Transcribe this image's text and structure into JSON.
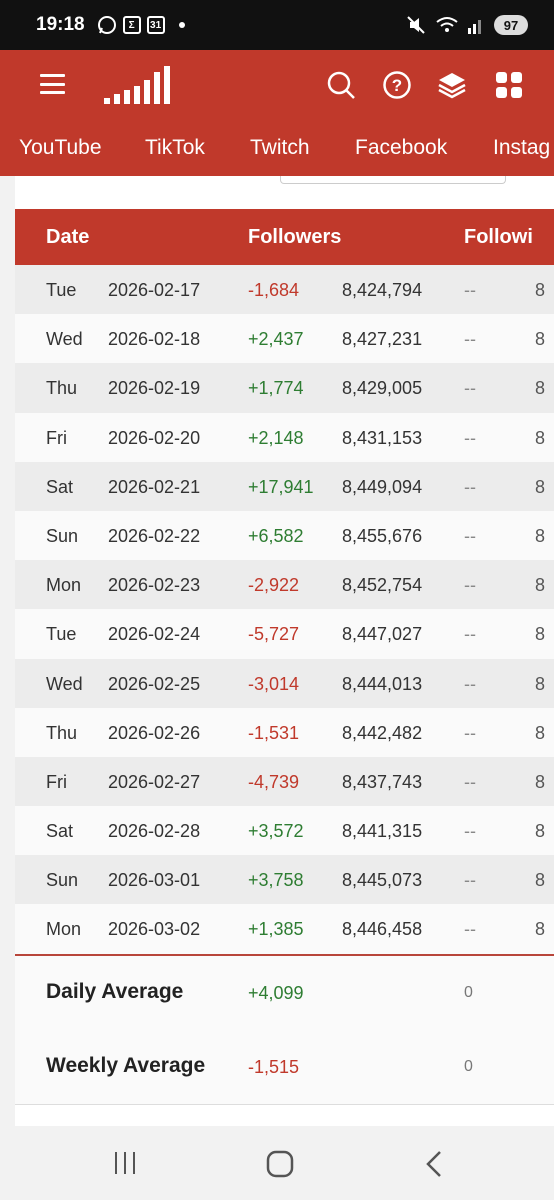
{
  "status_bar": {
    "time": "19:18",
    "calendar_day": "31",
    "battery": "97"
  },
  "nav_tabs": [
    "YouTube",
    "TikTok",
    "Twitch",
    "Facebook",
    "Instag"
  ],
  "table": {
    "headers": [
      "Date",
      "Followers",
      "Followi"
    ],
    "rows": [
      {
        "day": "Tue",
        "date": "2026-02-17",
        "change": "-1,684",
        "total": "8,424,794",
        "following": "--",
        "clip": "8"
      },
      {
        "day": "Wed",
        "date": "2026-02-18",
        "change": "+2,437",
        "total": "8,427,231",
        "following": "--",
        "clip": "8"
      },
      {
        "day": "Thu",
        "date": "2026-02-19",
        "change": "+1,774",
        "total": "8,429,005",
        "following": "--",
        "clip": "8"
      },
      {
        "day": "Fri",
        "date": "2026-02-20",
        "change": "+2,148",
        "total": "8,431,153",
        "following": "--",
        "clip": "8"
      },
      {
        "day": "Sat",
        "date": "2026-02-21",
        "change": "+17,941",
        "total": "8,449,094",
        "following": "--",
        "clip": "8"
      },
      {
        "day": "Sun",
        "date": "2026-02-22",
        "change": "+6,582",
        "total": "8,455,676",
        "following": "--",
        "clip": "8"
      },
      {
        "day": "Mon",
        "date": "2026-02-23",
        "change": "-2,922",
        "total": "8,452,754",
        "following": "--",
        "clip": "8"
      },
      {
        "day": "Tue",
        "date": "2026-02-24",
        "change": "-5,727",
        "total": "8,447,027",
        "following": "--",
        "clip": "8"
      },
      {
        "day": "Wed",
        "date": "2026-02-25",
        "change": "-3,014",
        "total": "8,444,013",
        "following": "--",
        "clip": "8"
      },
      {
        "day": "Thu",
        "date": "2026-02-26",
        "change": "-1,531",
        "total": "8,442,482",
        "following": "--",
        "clip": "8"
      },
      {
        "day": "Fri",
        "date": "2026-02-27",
        "change": "-4,739",
        "total": "8,437,743",
        "following": "--",
        "clip": "8"
      },
      {
        "day": "Sat",
        "date": "2026-02-28",
        "change": "+3,572",
        "total": "8,441,315",
        "following": "--",
        "clip": "8"
      },
      {
        "day": "Sun",
        "date": "2026-03-01",
        "change": "+3,758",
        "total": "8,445,073",
        "following": "--",
        "clip": "8"
      },
      {
        "day": "Mon",
        "date": "2026-03-02",
        "change": "+1,385",
        "total": "8,446,458",
        "following": "--",
        "clip": "8"
      }
    ]
  },
  "averages": {
    "daily": {
      "label": "Daily Average",
      "value": "+4,099",
      "following": "0"
    },
    "weekly": {
      "label": "Weekly Average",
      "value": "-1,515",
      "following": "0"
    }
  },
  "colors": {
    "brand": "#c0392b",
    "positive": "#2e7d32",
    "negative": "#c0392b"
  },
  "icons": [
    "whatsapp-icon",
    "sigma-app-icon",
    "calendar-icon",
    "mute-icon",
    "wifi-icon",
    "signal-icon",
    "battery-icon",
    "hamburger-menu-icon",
    "signal-bars-logo",
    "search-icon",
    "help-icon",
    "layers-icon",
    "grid-icon",
    "recent-apps-icon",
    "home-icon",
    "back-icon"
  ]
}
